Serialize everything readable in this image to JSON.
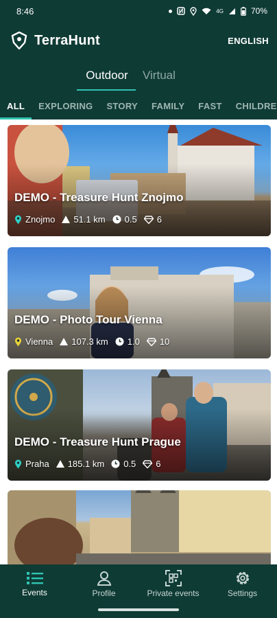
{
  "status_bar": {
    "time": "8:46",
    "signal": "4G",
    "battery": "70%"
  },
  "header": {
    "title": "TerraHunt",
    "language": "ENGLISH",
    "logo_icon": "location-shield-icon"
  },
  "mode_tabs": [
    {
      "label": "Outdoor",
      "active": true
    },
    {
      "label": "Virtual",
      "active": false
    }
  ],
  "category_tabs": [
    {
      "label": "ALL",
      "active": true
    },
    {
      "label": "EXPLORING",
      "active": false
    },
    {
      "label": "STORY",
      "active": false
    },
    {
      "label": "FAMILY",
      "active": false
    },
    {
      "label": "FAST",
      "active": false
    },
    {
      "label": "CHILDREN",
      "active": false
    }
  ],
  "events": [
    {
      "title": "DEMO - Treasure Hunt Znojmo",
      "city": "Znojmo",
      "distance": "51.1 km",
      "duration": "0.5",
      "points": "6",
      "pin_color": "#2fd0c6"
    },
    {
      "title": "DEMO - Photo Tour Vienna",
      "city": "Vienna",
      "distance": "107.3 km",
      "duration": "1.0",
      "points": "10",
      "pin_color": "#e8d23a"
    },
    {
      "title": "DEMO - Treasure Hunt Prague",
      "city": "Praha",
      "distance": "185.1 km",
      "duration": "0.5",
      "points": "6",
      "pin_color": "#2fd0c6"
    },
    {
      "title": "",
      "city": "",
      "distance": "",
      "duration": "",
      "points": "",
      "pin_color": "#2fd0c6"
    }
  ],
  "bottom_nav": [
    {
      "label": "Events",
      "icon": "list-icon",
      "active": true
    },
    {
      "label": "Profile",
      "icon": "profile-icon",
      "active": false
    },
    {
      "label": "Private events",
      "icon": "qr-scan-icon",
      "active": false
    },
    {
      "label": "Settings",
      "icon": "gear-icon",
      "active": false
    }
  ],
  "colors": {
    "primary": "#0f3b35",
    "accent": "#2fc4b2"
  }
}
